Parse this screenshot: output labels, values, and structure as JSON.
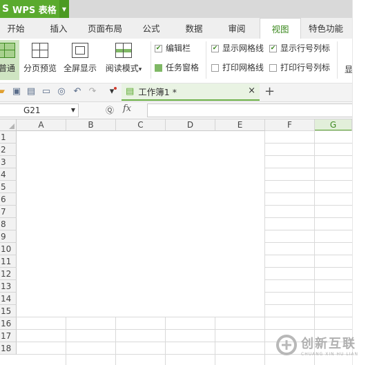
{
  "app": {
    "name": "WPS 表格",
    "logo": "S"
  },
  "menu": [
    "开始",
    "插入",
    "页面布局",
    "公式",
    "数据",
    "审阅",
    "视图",
    "特色功能"
  ],
  "active_menu": "视图",
  "ribbon": {
    "buttons": [
      {
        "label": "普通",
        "icon": "normal-view-icon",
        "selected": true
      },
      {
        "label": "分页预览",
        "icon": "page-break-preview-icon",
        "selected": false
      },
      {
        "label": "全屏显示",
        "icon": "fullscreen-icon",
        "selected": false
      },
      {
        "label": "阅读模式",
        "icon": "reading-mode-icon",
        "selected": false,
        "dropdown": "▾"
      }
    ],
    "checks": [
      {
        "label": "编辑栏",
        "checked": true
      },
      {
        "label": "任务窗格",
        "checked": false,
        "style": "green"
      },
      {
        "label": "显示网格线",
        "checked": true
      },
      {
        "label": "打印网格线",
        "checked": false
      },
      {
        "label": "显示行号列标",
        "checked": true
      },
      {
        "label": "打印行号列标",
        "checked": false
      }
    ],
    "overflow": "显"
  },
  "doc_tab": {
    "title": "工作簿1 *",
    "close": "×",
    "add": "+"
  },
  "formula_bar": {
    "cell_ref": "G21",
    "fx": "fx",
    "value": ""
  },
  "columns": [
    "A",
    "B",
    "C",
    "D",
    "E",
    "F",
    "G"
  ],
  "selected_column": "G",
  "rows": [
    "1",
    "2",
    "3",
    "4",
    "5",
    "6",
    "7",
    "8",
    "9",
    "10",
    "11",
    "12",
    "13",
    "14",
    "15",
    "16",
    "17",
    "18"
  ],
  "watermark": {
    "text": "创新互联",
    "sub": "CHUANG XIN HU LIAN"
  },
  "colors": {
    "accent": "#5aaa2e",
    "grid": "#d9d9d9"
  }
}
